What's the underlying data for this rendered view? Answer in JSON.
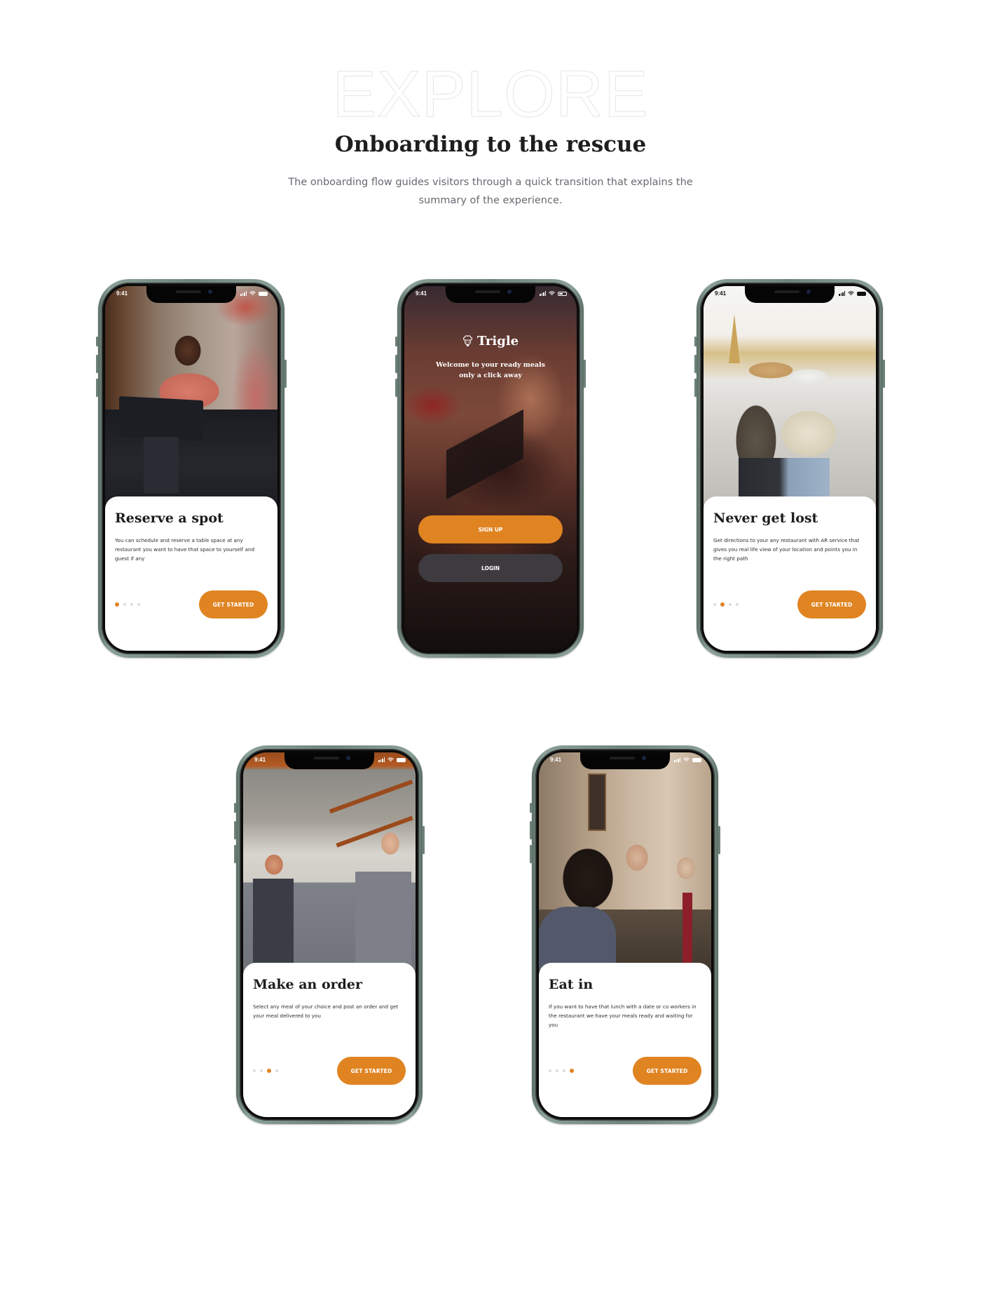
{
  "hero": {
    "background_word": "EXPLORE",
    "title": "Onboarding to the rescue",
    "subtitle": "The onboarding flow guides visitors through a quick transition that explains the summary of the experience."
  },
  "colors": {
    "accent": "#E08422",
    "login_button": "#3D3B3F",
    "phone_frame": "#6E8379",
    "title_text": "#1E1E1E",
    "subtitle_text": "#6C6771"
  },
  "status_bar": {
    "time": "9:41",
    "icons": [
      "signal-icon",
      "wifi-icon",
      "battery-icon"
    ]
  },
  "screens": [
    {
      "id": "reserve",
      "photo": "woman-at-register-photo",
      "title": "Reserve a spot",
      "text": "You can schedule and reserve a table space at any restaurant you want to have that space to yourself and guest if any",
      "button": "GET STARTED",
      "page_index": 0,
      "page_count": 4
    },
    {
      "id": "welcome",
      "photo": "woman-reading-menu-photo",
      "brand": "Trigle",
      "brand_icon": "chef-hat-icon",
      "tagline_line1": "Welcome to your ready meals",
      "tagline_line2": "only a click away",
      "signup": "SIGN UP",
      "login": "LOGIN"
    },
    {
      "id": "lost",
      "photo": "tourists-with-map-photo",
      "title": "Never get lost",
      "text": "Get directions to your any restaurant with AR service that gives you real life view of your location and points you in the right path",
      "button": "GET STARTED",
      "page_index": 1,
      "page_count": 4
    },
    {
      "id": "order",
      "photo": "kitchen-staff-photo",
      "title": "Make an order",
      "text": "Select any meal of your choice and post an order and get your meal delivered to you",
      "button": "GET STARTED",
      "page_index": 2,
      "page_count": 4
    },
    {
      "id": "eat",
      "photo": "friends-dining-photo",
      "title": "Eat in",
      "text": "If you want to have that lunch with a date or co workers in the restaurant we have your meals ready and waiting for you",
      "button": "GET STARTED",
      "page_index": 3,
      "page_count": 4
    }
  ]
}
